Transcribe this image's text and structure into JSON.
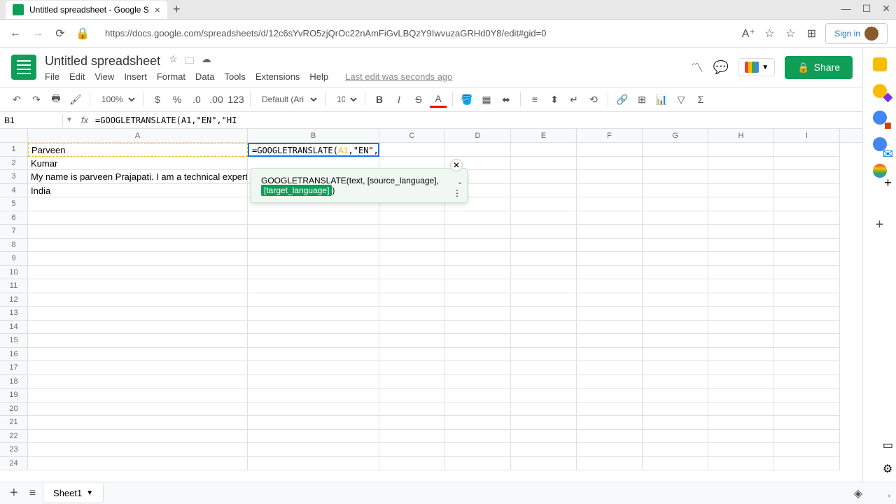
{
  "browser": {
    "tab_title": "Untitled spreadsheet - Google S",
    "url": "https://docs.google.com/spreadsheets/d/12c6sYvRO5zjQrOc22nAmFiGvLBQzY9IwvuzaGRHd0Y8/edit#gid=0",
    "signin": "Sign in"
  },
  "app": {
    "doc_title": "Untitled spreadsheet",
    "last_edit": "Last edit was seconds ago",
    "share": "Share",
    "menus": [
      "File",
      "Edit",
      "View",
      "Insert",
      "Format",
      "Data",
      "Tools",
      "Extensions",
      "Help"
    ]
  },
  "toolbar": {
    "zoom": "100%",
    "font": "Default (Ari",
    "font_size": "10",
    "more_fmt": "123"
  },
  "formula_bar": {
    "cell_ref": "B1",
    "formula": "=GOOGLETRANSLATE(A1,\"EN\",\"HI"
  },
  "cells": {
    "A1": "Parveen",
    "A2": "Kumar",
    "A3": "My name is parveen Prajapati. I am a technical expert",
    "A4": "India",
    "B1_prefix": "=GOOGLETRANSLATE(",
    "B1_ref": "A1",
    "B1_mid": ",\"EN\",\"HI"
  },
  "columns": [
    "A",
    "B",
    "C",
    "D",
    "E",
    "F",
    "G",
    "H",
    "I"
  ],
  "hint": {
    "line1": "GOOGLETRANSLATE(text, [source_language],",
    "highlight": "[target_language]",
    "after": ")"
  },
  "sheet_tab": {
    "name": "Sheet1"
  }
}
